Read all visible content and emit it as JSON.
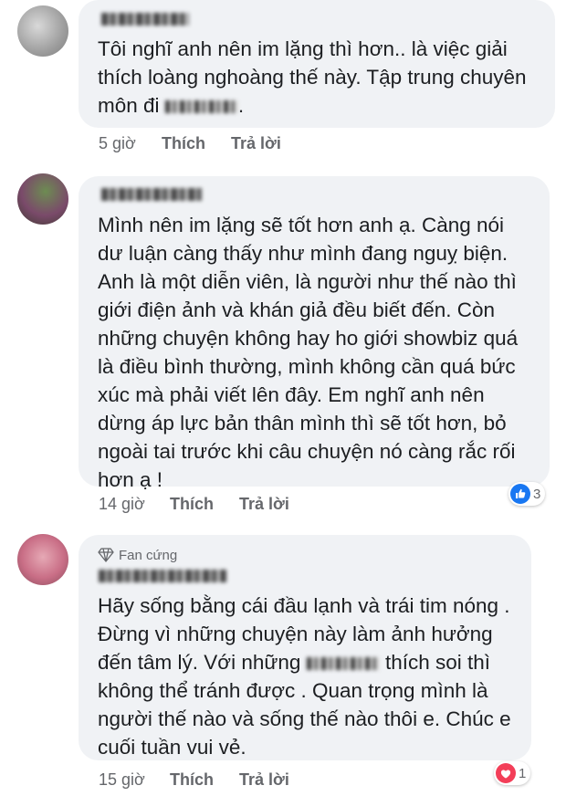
{
  "comments": [
    {
      "text_pre": "Tôi nghĩ anh nên im lặng thì hơn.. là việc giải thích loàng nghoàng thế này. Tập trung chuyên môn đi",
      "text_post": ".",
      "time": "5 giờ",
      "like_label": "Thích",
      "reply_label": "Trả lời"
    },
    {
      "text": "Mình nên im lặng sẽ tốt hơn anh ạ. Càng nói dư luận càng thấy như mình đang nguỵ biện. Anh là một diễn viên, là người như thế nào thì giới điện ảnh và khán giả đều biết đến. Còn những chuyện không hay ho giới showbiz quá là điều bình thường, mình không cần quá bức xúc mà phải viết lên đây. Em nghĩ anh nên dừng áp lực bản thân mình thì sẽ tốt hơn, bỏ ngoài tai trước khi câu chuyện nó càng rắc rối hơn ạ !",
      "time": "14 giờ",
      "like_label": "Thích",
      "reply_label": "Trả lời",
      "reaction": {
        "icon": "like-icon",
        "count": "3",
        "color": "#1877f2"
      }
    },
    {
      "badge": "Fan cứng",
      "text_pre": "Hãy sống bằng cái đầu lạnh và trái tim nóng . Đừng vì những chuyện này làm ảnh hưởng đến tâm lý. Với những",
      "text_post": "thích soi thì không thể tránh được . Quan trọng mình là người thế nào và sống thế nào thôi e. Chúc e cuối tuần vui vẻ.",
      "time": "15 giờ",
      "like_label": "Thích",
      "reply_label": "Trả lời",
      "reaction": {
        "icon": "heart-icon",
        "count": "1",
        "color": "#f33e58"
      }
    }
  ]
}
